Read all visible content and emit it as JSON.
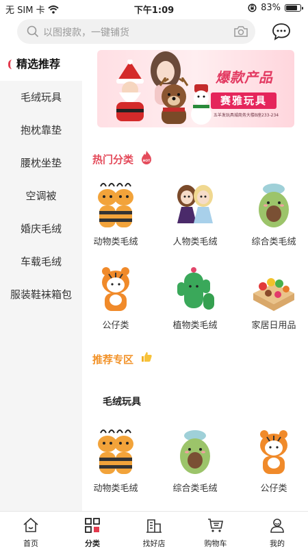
{
  "status_bar": {
    "carrier": "无 SIM 卡",
    "time": "下午1:09",
    "battery_percent": "83%",
    "battery_level": 0.83,
    "icons": [
      "wifi-icon",
      "orientation-lock-icon",
      "battery-icon"
    ]
  },
  "search": {
    "placeholder": "以图搜款，一键铺货",
    "icons": [
      "search-icon",
      "camera-icon",
      "message-icon"
    ]
  },
  "sidebar": {
    "items": [
      {
        "label": "精选推荐",
        "active": true
      },
      {
        "label": "毛绒玩具",
        "active": false
      },
      {
        "label": "抱枕靠垫",
        "active": false
      },
      {
        "label": "腰枕坐垫",
        "active": false
      },
      {
        "label": "空调被",
        "active": false
      },
      {
        "label": "婚庆毛绒",
        "active": false
      },
      {
        "label": "车载毛绒",
        "active": false
      },
      {
        "label": "服装鞋袜箱包",
        "active": false
      }
    ]
  },
  "banner": {
    "title": "爆款产品",
    "brand": "赛雅玩具",
    "address": "五羊发玩具城商务大楼B座233-234"
  },
  "hot_section": {
    "title": "热门分类",
    "badge": "HOT",
    "categories": [
      {
        "label": "动物类毛绒",
        "icon": "bee-plush-icon"
      },
      {
        "label": "人物类毛绒",
        "icon": "doll-plush-icon"
      },
      {
        "label": "综合类毛绒",
        "icon": "avocado-plush-icon"
      },
      {
        "label": "公仔类",
        "icon": "tiger-plush-icon"
      },
      {
        "label": "植物类毛绒",
        "icon": "cactus-plush-icon"
      },
      {
        "label": "家居日用品",
        "icon": "food-toy-box-icon"
      }
    ]
  },
  "recommend_section": {
    "title": "推荐专区",
    "subtitle": "毛绒玩具",
    "items": [
      {
        "label": "动物类毛绒",
        "icon": "bee-plush-icon"
      },
      {
        "label": "综合类毛绒",
        "icon": "avocado-plush-icon"
      },
      {
        "label": "公仔类",
        "icon": "tiger-plush-icon"
      }
    ]
  },
  "tab_bar": {
    "tabs": [
      {
        "label": "首页",
        "icon": "home-icon",
        "active": false
      },
      {
        "label": "分类",
        "icon": "category-icon",
        "active": true
      },
      {
        "label": "找好店",
        "icon": "store-icon",
        "active": false
      },
      {
        "label": "购物车",
        "icon": "cart-icon",
        "active": false
      },
      {
        "label": "我的",
        "icon": "profile-icon",
        "active": false
      }
    ]
  },
  "colors": {
    "accent": "#e33a4e",
    "hot_title": "#e44b5b",
    "recommend_title": "#f2932a"
  }
}
